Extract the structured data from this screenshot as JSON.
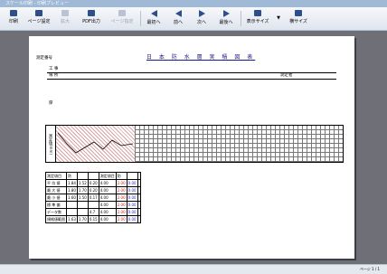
{
  "window": {
    "title": "スケール印刷 - 印刷プレビュー"
  },
  "toolbar": {
    "buttons": [
      {
        "label": "印刷"
      },
      {
        "label": "ページ設定"
      },
      {
        "label": "PDF出力"
      },
      {
        "label": "最初へ"
      },
      {
        "label": "前へ"
      },
      {
        "label": "次へ"
      },
      {
        "label": "最後へ"
      },
      {
        "label": "表示サイズ"
      },
      {
        "label": "横サイズ"
      }
    ],
    "disabled_buttons": [
      {
        "label": "拡大"
      },
      {
        "label": "ページ指定"
      }
    ]
  },
  "page": {
    "doc_title": "日 本 防 水 層 実 積 図 表",
    "left_code": "測定番号",
    "row1_label": "工 事",
    "row2_label": "場 所",
    "right_label": "測定者",
    "chart_label_top": "厚",
    "chart_label_side": "測定値(mm)",
    "table": {
      "header_left": [
        "測定項目",
        "防",
        "測定項目",
        "防"
      ],
      "rows": [
        {
          "label": "平 均 値",
          "a": "1.84",
          "b": "1.52",
          "c": "0.20",
          "d": "4.00",
          "e": "2.00",
          "f": "0.00"
        },
        {
          "label": "最 大 値",
          "a": "1.80",
          "b": "1.70",
          "c": "0.20",
          "d": "4.00",
          "e": "2.00",
          "f": "0.00"
        },
        {
          "label": "最 小 値",
          "a": "1.60",
          "b": "1.50",
          "c": "0.17",
          "d": "4.00",
          "e": "2.00",
          "f": "0.00"
        },
        {
          "label": "標 準 偏",
          "a": "",
          "b": "",
          "c": "",
          "d": "4.00",
          "e": "2.00",
          "f": "0.00"
        },
        {
          "label": "データ数",
          "a": "",
          "b": "",
          "c": "4.7",
          "d": "4.00",
          "e": "2.00",
          "f": "0.00"
        },
        {
          "label": "規格値範囲",
          "a": "1.63",
          "b": "1.70",
          "c": "0.15",
          "d": "4.00",
          "e": "2.00",
          "f": "0.00"
        }
      ]
    }
  },
  "status": {
    "text": "ページ 1 / 1"
  },
  "colors": {
    "toolbar_bg": "#dfe5ee",
    "viewer_bg": "#6f6f78",
    "hatch": "#d9a3a3"
  }
}
